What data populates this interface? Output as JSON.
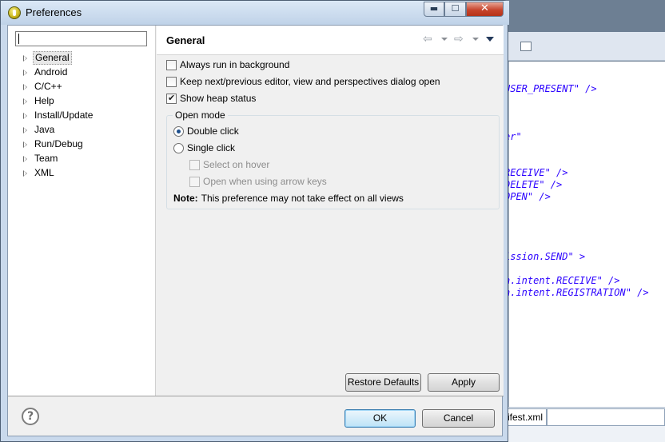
{
  "dialog": {
    "title": "Preferences",
    "window_controls": {
      "minimize": "▬",
      "maximize": "☐",
      "close": "✕"
    }
  },
  "filter": {
    "value": "",
    "placeholder": ""
  },
  "tree": {
    "items": [
      {
        "label": "General",
        "selected": true
      },
      {
        "label": "Android"
      },
      {
        "label": "C/C++"
      },
      {
        "label": "Help"
      },
      {
        "label": "Install/Update"
      },
      {
        "label": "Java"
      },
      {
        "label": "Run/Debug"
      },
      {
        "label": "Team"
      },
      {
        "label": "XML"
      }
    ]
  },
  "page": {
    "title": "General",
    "nav_back": "⇦",
    "nav_forward": "⇨",
    "options": {
      "always_run_background": {
        "label": "Always run in background",
        "checked": false
      },
      "keep_next_prev": {
        "label": "Keep next/previous editor, view and perspectives dialog open",
        "checked": false
      },
      "show_heap": {
        "label": "Show heap status",
        "checked": true
      }
    },
    "open_mode": {
      "title": "Open mode",
      "double_click": {
        "label": "Double click",
        "selected": true
      },
      "single_click": {
        "label": "Single click",
        "selected": false
      },
      "select_on_hover": {
        "label": "Select on hover",
        "enabled": false
      },
      "open_arrow_keys": {
        "label": "Open when using arrow keys",
        "enabled": false
      },
      "note_label": "Note:",
      "note_text": "This preference may not take effect on all views"
    },
    "restore_defaults_label": "Restore Defaults",
    "apply_label": "Apply"
  },
  "footer": {
    "help": "?",
    "ok_label": "OK",
    "cancel_label": "Cancel"
  },
  "background_editor": {
    "code_lines": [
      "USER_PRESENT\" />",
      "er\"",
      "RECEIVE\" />",
      "DELETE\" />",
      "OPEN\" />",
      "ission.SEND\" >",
      "n.intent.RECEIVE\" />",
      "n.intent.REGISTRATION\" />"
    ],
    "tab_label": "ifest.xml"
  }
}
